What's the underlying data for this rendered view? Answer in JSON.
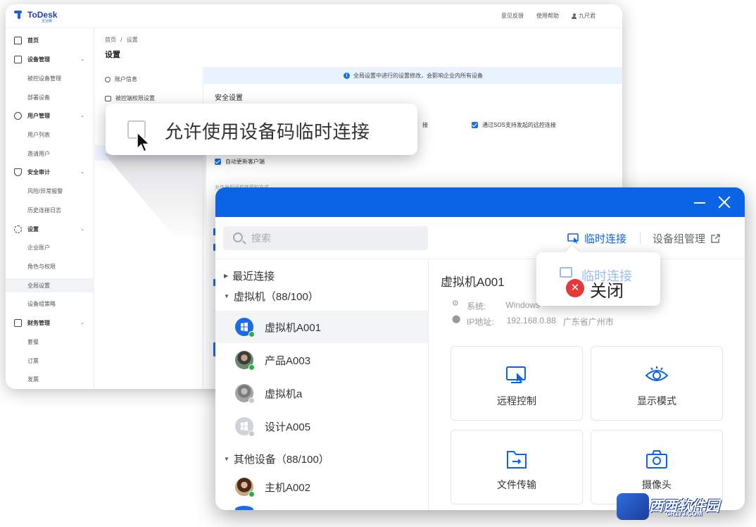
{
  "admin": {
    "logo": "ToDesk",
    "logo_sub": "企业版",
    "top_links": [
      "意见反馈",
      "使用帮助"
    ],
    "user_name": "九尺君",
    "sidebar": [
      {
        "label": "首页",
        "type": "parent"
      },
      {
        "label": "设备管理",
        "type": "parent",
        "chevron": "⌄"
      },
      {
        "label": "被控设备管理",
        "type": "child"
      },
      {
        "label": "部署设备",
        "type": "child"
      },
      {
        "label": "用户管理",
        "type": "parent",
        "chevron": "⌄"
      },
      {
        "label": "用户列表",
        "type": "child"
      },
      {
        "label": "邀请用户",
        "type": "child"
      },
      {
        "label": "安全审计",
        "type": "parent",
        "chevron": "⌄"
      },
      {
        "label": "风险/异常报警",
        "type": "child"
      },
      {
        "label": "历史连接日志",
        "type": "child"
      },
      {
        "label": "设置",
        "type": "parent",
        "chevron": "⌄"
      },
      {
        "label": "企业账户",
        "type": "child"
      },
      {
        "label": "角色与权限",
        "type": "child"
      },
      {
        "label": "全局设置",
        "type": "child"
      },
      {
        "label": "设备组策略",
        "type": "child"
      },
      {
        "label": "财务管理",
        "type": "parent",
        "chevron": "⌄"
      },
      {
        "label": "套餐",
        "type": "child"
      },
      {
        "label": "订票",
        "type": "child"
      },
      {
        "label": "发票",
        "type": "child"
      }
    ],
    "breadcrumb": {
      "home": "首页",
      "sep": "/",
      "current": "设置"
    },
    "page_title": "设置",
    "subnav": [
      "账户信息",
      "被控端权限设置"
    ],
    "notice": "全局设置中进行的设置修改，会影响企业内所有设备",
    "section_title": "安全设置",
    "options": {
      "partial_right": "接",
      "sos": "通过SOS支持发起的远控连接",
      "auto_update": "自动更新客户端",
      "connect_methods": "允许发起远控连接的方式"
    },
    "callout": "允许使用设备码临时连接"
  },
  "client": {
    "search_placeholder": "搜索",
    "tab_temp": "临时连接",
    "tab_group": "设备组管理",
    "groups": [
      {
        "label": "最近连接",
        "expanded": false
      },
      {
        "label": "虚拟机（88/100）",
        "expanded": true
      },
      {
        "label": "其他设备（88/100）",
        "expanded": true
      }
    ],
    "devices": [
      {
        "name": "虚拟机A001",
        "status": "online",
        "selected": true,
        "avatar": "windows"
      },
      {
        "name": "产品A003",
        "status": "online",
        "selected": false,
        "avatar": "person-dark"
      },
      {
        "name": "虚拟机a",
        "status": "offline",
        "selected": false,
        "avatar": "person-gray"
      },
      {
        "name": "设计A005",
        "status": "offline",
        "selected": false,
        "avatar": "windows-gray"
      },
      {
        "name": "主机A002",
        "status": "online",
        "selected": false,
        "avatar": "person-woman"
      }
    ],
    "detail": {
      "title": "虚拟机A001",
      "system_label": "系统:",
      "system_value": "Windows",
      "ip_label": "IP地址:",
      "ip_value": "192.168.0.88",
      "location": "广东省广州市"
    },
    "actions": [
      "远程控制",
      "显示模式",
      "文件传输",
      "摄像头"
    ],
    "tooltip": {
      "back": "临时连接",
      "close": "关闭"
    }
  },
  "watermark": {
    "name": "西西软件园",
    "url": "CR173.COM"
  },
  "colors": {
    "brand": "#0b63e5",
    "online": "#1fb44a",
    "offline": "#c8c8c8",
    "close": "#e5383b"
  }
}
